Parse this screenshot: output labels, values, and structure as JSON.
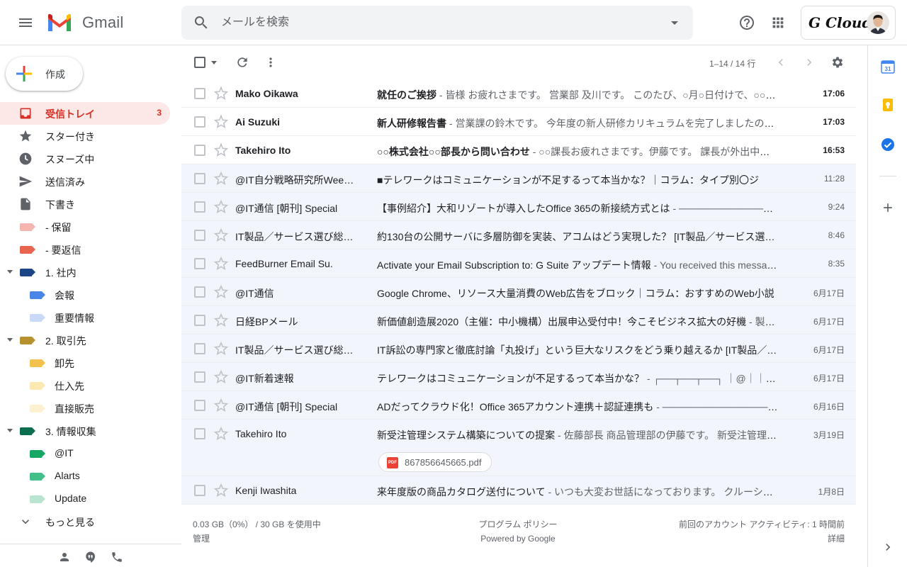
{
  "header": {
    "logo_text": "Gmail",
    "search_placeholder": "メールを検索",
    "account_brand": "G Cloud"
  },
  "sidebar": {
    "compose_label": "作成",
    "items": [
      {
        "label": "受信トレイ",
        "count": "3",
        "icon": "inbox-icon"
      },
      {
        "label": "スター付き",
        "icon": "star-icon"
      },
      {
        "label": "スヌーズ中",
        "icon": "clock-icon"
      },
      {
        "label": "送信済み",
        "icon": "send-icon"
      },
      {
        "label": "下書き",
        "icon": "draft-icon"
      },
      {
        "label": "- 保留",
        "icon": "label-icon",
        "color": "#f4b6ae"
      },
      {
        "label": "- 要返信",
        "icon": "label-icon",
        "color": "#e8644f"
      },
      {
        "label": "1. 社内",
        "icon": "label-icon",
        "color": "#1c4587"
      },
      {
        "label": "会報",
        "icon": "label-icon",
        "color": "#4a86e8"
      },
      {
        "label": "重要情報",
        "icon": "label-icon",
        "color": "#c9daf8"
      },
      {
        "label": "2. 取引先",
        "icon": "label-icon",
        "color": "#b8912f"
      },
      {
        "label": "卸先",
        "icon": "label-icon",
        "color": "#f2c14e"
      },
      {
        "label": "仕入先",
        "icon": "label-icon",
        "color": "#fce8b2"
      },
      {
        "label": "直接販売",
        "icon": "label-icon",
        "color": "#fef1d1"
      },
      {
        "label": "3. 情報収集",
        "icon": "label-icon",
        "color": "#0b6e4f"
      },
      {
        "label": "@IT",
        "icon": "label-icon",
        "color": "#16a765"
      },
      {
        "label": "Alarts",
        "icon": "label-icon",
        "color": "#43c08a"
      },
      {
        "label": "Update",
        "icon": "label-icon",
        "color": "#b9e4d0"
      },
      {
        "label": "もっと見る",
        "icon": "chevron-down-icon"
      }
    ]
  },
  "toolbar": {
    "range": "1–14 / 14 行"
  },
  "emails": [
    {
      "sender": "Mako Oikawa",
      "subject": "就任のご挨拶",
      "snippet": " - 皆様 お疲れさまです。 営業部 及川です。 このたび、○月○日付けで、○○部長に就任いたしました。",
      "date": "17:06",
      "unread": true
    },
    {
      "sender": "Ai Suzuki",
      "subject": "新人研修報告書",
      "snippet": " - 営業課の鈴木です。 今年度の新人研修カリキュラムを完了しましたので報告いたします。",
      "date": "17:03",
      "unread": true
    },
    {
      "sender": "Takehiro Ito",
      "subject": "○○株式会社○○部長から問い合わせ",
      "snippet": " - ○○課長お疲れさまです。伊藤です。 課長が外出中に問い合わせがありました。",
      "date": "16:53",
      "unread": true
    },
    {
      "sender": "@IT自分戦略研究所Weekly",
      "subject": "■テレワークはコミュニケーションが不足するって本当かな？｜コラム：タイプ別〇ジ",
      "snippet": "",
      "date": "11:28",
      "unread": false
    },
    {
      "sender": "@IT通信 [朝刊] Special",
      "subject": "【事例紹介】大和リゾートが導入したOffice 365の新接続方式とは",
      "snippet": " - ──────────────────",
      "date": "9:24",
      "unread": false
    },
    {
      "sender": "IT製品／サービス選び総合ガイド",
      "subject": "約130台の公開サーバに多層防御を実装、アコムはどう実現した？ [IT製品／サービス選び総合ガイド]",
      "snippet": "",
      "date": "8:46",
      "unread": false
    },
    {
      "sender": "FeedBurner Email Su.",
      "subject": "Activate your Email Subscription to: G Suite アップデート情報",
      "snippet": " - You received this message because you subscribed",
      "date": "8:35",
      "unread": false
    },
    {
      "sender": "@IT通信",
      "subject": "Google Chrome、リソース大量消費のWeb広告をブロック｜コラム：おすすめのWeb小説",
      "snippet": "",
      "date": "6月17日",
      "unread": false
    },
    {
      "sender": "日経BPメール",
      "subject": "新価値創造展2020（主催：中小機構）出展申込受付中！今こそビジネス拡大の好機",
      "snippet": " - 製品・サービスのご案内",
      "date": "6月17日",
      "unread": false
    },
    {
      "sender": "IT製品／サービス選び総合ガイド",
      "subject": "IT訴訟の専門家と徹底討論「丸投げ」という巨大なリスクをどう乗り越えるか [IT製品／サービス選び総合ガイド]",
      "snippet": "",
      "date": "6月17日",
      "unread": false
    },
    {
      "sender": "@IT新着速報",
      "subject": "テレワークはコミュニケーションが不足するって本当かな？",
      "snippet": " - ┌──┬──┬──┐ ｜@｜｜I｜｜T｜",
      "date": "6月17日",
      "unread": false
    },
    {
      "sender": "@IT通信 [朝刊] Special",
      "subject": "ADだってクラウド化！Office 365アカウント連携＋認証連携も",
      "snippet": " - ──────────────────",
      "date": "6月16日",
      "unread": false
    },
    {
      "sender": "Takehiro Ito",
      "subject": "新受注管理システム構築についての提案",
      "snippet": " - 佐藤部長 商品管理部の伊藤です。 新受注管理システムの構築について提案いたします。",
      "date": "3月19日",
      "unread": false,
      "attachment": "867856645665.pdf"
    },
    {
      "sender": "Kenji Iwashita",
      "subject": "来年度版の商品カタログ送付について",
      "snippet": " - いつも大変お世話になっております。 クルーシャの岩下です。",
      "date": "1月8日",
      "unread": false
    }
  ],
  "footer": {
    "storage": "0.03 GB（0%） / 30 GB を使用中",
    "manage": "管理",
    "policy": "プログラム ポリシー",
    "powered": "Powered by Google",
    "activity": "前回のアカウント アクティビティ: 1 時間前",
    "details": "詳細"
  },
  "rail": {
    "calendar_day": "31"
  }
}
